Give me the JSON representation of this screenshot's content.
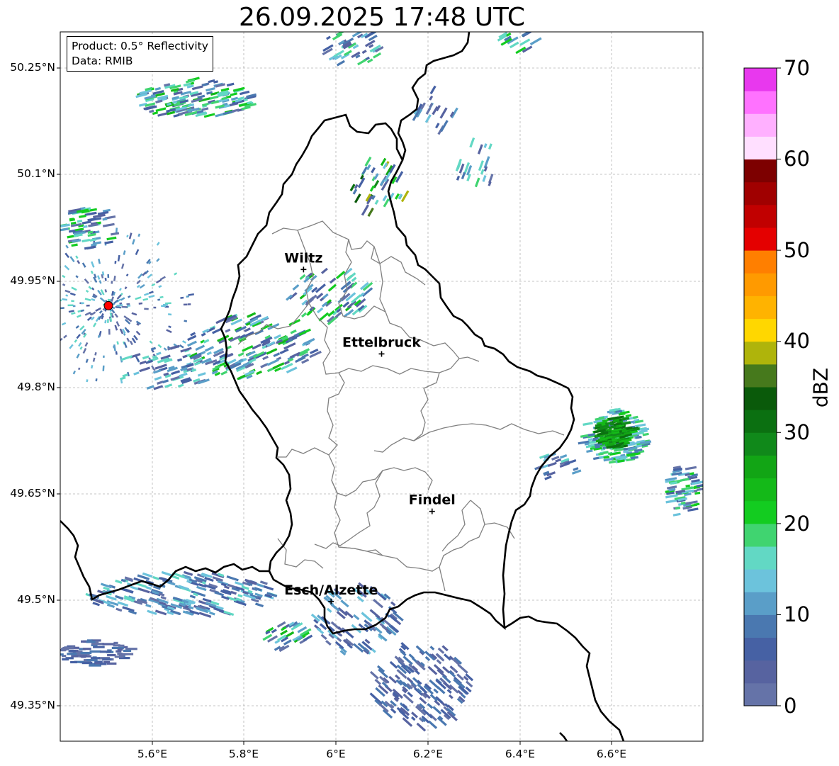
{
  "title": "26.09.2025 17:48 UTC",
  "info_box": {
    "product": "Product: 0.5° Reflectivity",
    "data_source": "Data: RMIB"
  },
  "axes": {
    "y_ticks": [
      "50.25°N",
      "50.1°N",
      "49.95°N",
      "49.8°N",
      "49.65°N",
      "49.5°N",
      "49.35°N"
    ],
    "x_ticks": [
      "5.6°E",
      "5.8°E",
      "6°E",
      "6.2°E",
      "6.4°E",
      "6.6°E"
    ],
    "grid": true,
    "grid_style": "dashed"
  },
  "colorbar": {
    "label": "dBZ",
    "ticks": [
      "0",
      "10",
      "20",
      "30",
      "40",
      "50",
      "60",
      "70"
    ],
    "min": 0,
    "max": 70,
    "step": 2.5,
    "colors": [
      "#6573a8",
      "#5763a0",
      "#4661a4",
      "#4a78b0",
      "#5a9ec8",
      "#6cc3dc",
      "#62d8c4",
      "#40d470",
      "#13cc20",
      "#14b918",
      "#12a515",
      "#10891a",
      "#0b7011",
      "#0a5a0a",
      "#46791c",
      "#afb40b",
      "#ffd700",
      "#ffb300",
      "#ff9a00",
      "#ff7f00",
      "#e40000",
      "#c10000",
      "#a00000",
      "#7d0000",
      "#ffdfff",
      "#ffb0ff",
      "#ff72ff",
      "#e838ee"
    ]
  },
  "cities": [
    {
      "name": "Wiltz",
      "lon": 5.93,
      "lat": 49.965
    },
    {
      "name": "Ettelbruck",
      "lon": 6.1,
      "lat": 49.846
    },
    {
      "name": "Findel",
      "lon": 6.21,
      "lat": 49.624
    },
    {
      "name": "Esch/Alzette",
      "lon": 5.99,
      "lat": 49.497
    }
  ],
  "radar_site": {
    "lon": 5.505,
    "lat": 49.914,
    "color": "#ff0000"
  },
  "border_color": "#000000",
  "canton_color": "#808080",
  "map_extent": {
    "lon_min": 5.4,
    "lon_max": 6.8,
    "lat_min": 49.3,
    "lat_max": 50.3
  }
}
